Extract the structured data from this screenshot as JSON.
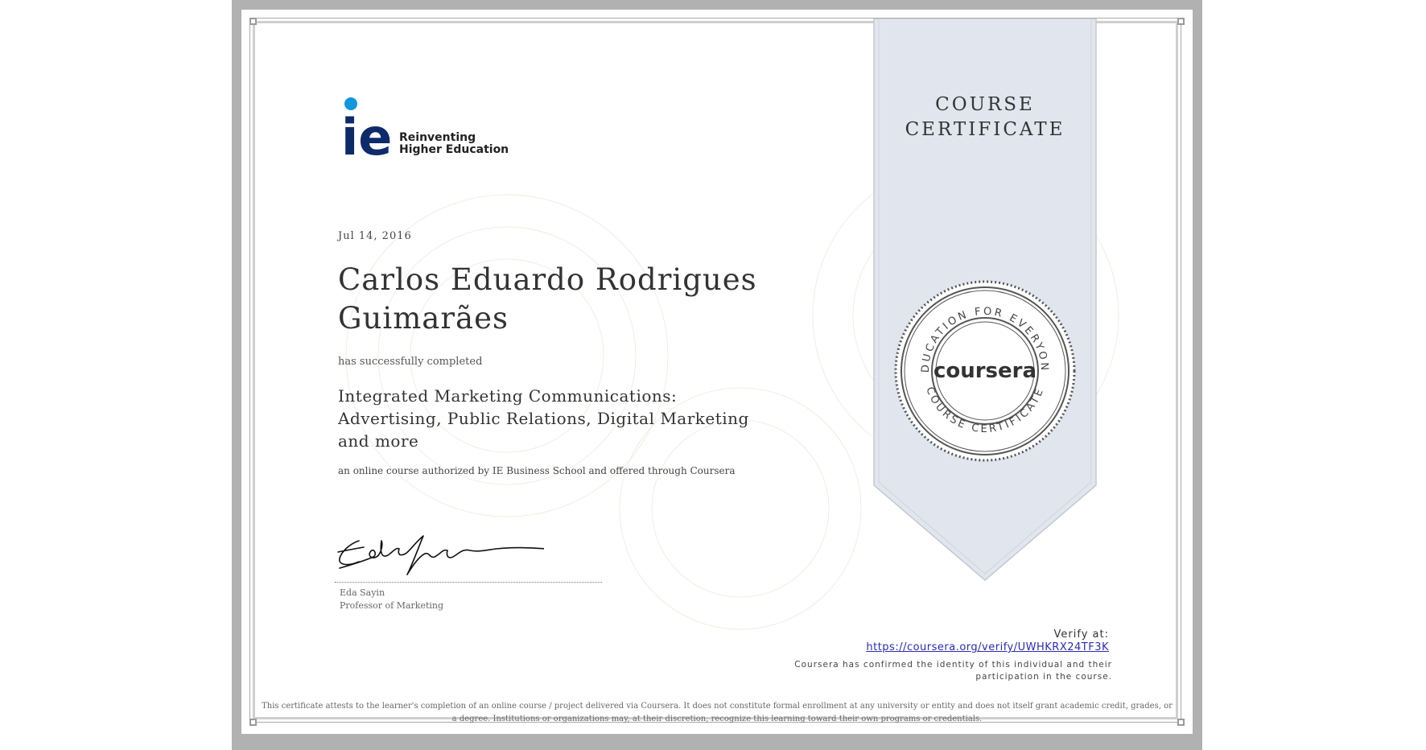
{
  "logo": {
    "brand_mark": "ie",
    "tagline_line1": "Reinventing",
    "tagline_line2": "Higher Education",
    "dot_color": "#1296dc",
    "text_color": "#0d2a6b"
  },
  "certificate": {
    "type_line1": "COURSE",
    "type_line2": "CERTIFICATE",
    "date": "Jul 14, 2016",
    "recipient_name": "Carlos Eduardo Rodrigues Guimarães",
    "completed_text": "has successfully completed",
    "course_title": "Integrated Marketing Communications: Advertising, Public Relations, Digital Marketing and more",
    "authorization": "an online course authorized by IE Business School and offered through Coursera"
  },
  "signatory": {
    "name": "Eda Sayin",
    "title": "Professor of Marketing"
  },
  "seal": {
    "brand": "coursera",
    "ring_top": "EDUCATION FOR EVERYONE",
    "ring_bottom": "COURSE CERTIFICATE"
  },
  "verification": {
    "label": "Verify at:",
    "url": "https://coursera.org/verify/UWHKRX24TF3K",
    "confirmation_line1": "Coursera has confirmed the identity of this individual and their",
    "confirmation_line2": "participation in the course."
  },
  "disclaimer": {
    "line1": "This certificate attests to the learner's completion of an online course / project delivered via Coursera. It does not constitute formal enrollment at any university or entity and does not itself grant academic credit, grades, or",
    "line2": "a degree. Institutions or organizations may, at their discretion, recognize this learning toward their own programs or credentials."
  },
  "colors": {
    "frame": "#b1b1b1",
    "ribbon": "#e1e6ee",
    "link": "#2a2ab8"
  }
}
